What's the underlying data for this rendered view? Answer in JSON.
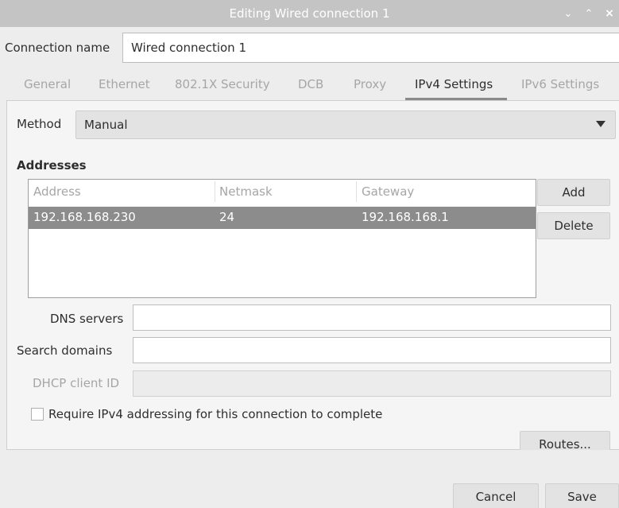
{
  "window": {
    "title": "Editing Wired connection 1",
    "controls": {
      "minimize": "⌄",
      "maximize": "⌃",
      "close": "×"
    }
  },
  "connection": {
    "label": "Connection name",
    "value": "Wired connection 1"
  },
  "tabs": [
    {
      "label": "General",
      "active": false
    },
    {
      "label": "Ethernet",
      "active": false
    },
    {
      "label": "802.1X Security",
      "active": false
    },
    {
      "label": "DCB",
      "active": false
    },
    {
      "label": "Proxy",
      "active": false
    },
    {
      "label": "IPv4 Settings",
      "active": true
    },
    {
      "label": "IPv6 Settings",
      "active": false
    }
  ],
  "ipv4": {
    "method_label": "Method",
    "method_value": "Manual",
    "addresses_label": "Addresses",
    "columns": [
      "Address",
      "Netmask",
      "Gateway"
    ],
    "rows": [
      {
        "address": "192.168.168.230",
        "netmask": "24",
        "gateway": "192.168.168.1"
      }
    ],
    "add_label": "Add",
    "delete_label": "Delete",
    "dns_label": "DNS servers",
    "dns_value": "",
    "search_label": "Search domains",
    "search_value": "",
    "dhcp_label": "DHCP client ID",
    "dhcp_value": "",
    "require_label": "Require IPv4 addressing for this connection to complete",
    "require_checked": false,
    "routes_label": "Routes..."
  },
  "footer": {
    "cancel_label": "Cancel",
    "save_label": "Save"
  },
  "colors": {
    "titlebar": "#c4c4c4",
    "selected_row": "#8c8c8c",
    "active_tab_underline": "#8a8a8a"
  }
}
